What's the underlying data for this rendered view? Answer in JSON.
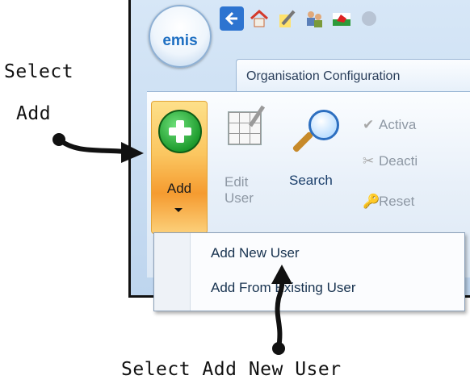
{
  "annotations": {
    "select_add_line1": "Select",
    "select_add_line2": "Add",
    "select_add_new_user": "Select Add New User"
  },
  "app": {
    "logo_text": "emis",
    "quick_access_icons": [
      "back-icon",
      "home-icon",
      "edit-pencil-icon",
      "users-icon",
      "wales-dragon-icon",
      "more-icon"
    ]
  },
  "tab": {
    "label": "Organisation Configuration"
  },
  "ribbon": {
    "add_label": "Add",
    "edit_line1": "Edit",
    "edit_line2": "User",
    "search_label": "Search",
    "activate_label": "Activa",
    "deactivate_label": "Deacti",
    "reset_label": "Reset"
  },
  "dropdown": {
    "items": [
      "Add New User",
      "Add From Existing User"
    ]
  },
  "colors": {
    "accent_orange": "#f59b30",
    "ribbon_blue": "#bed5ee",
    "plus_green": "#1e9c2e"
  }
}
